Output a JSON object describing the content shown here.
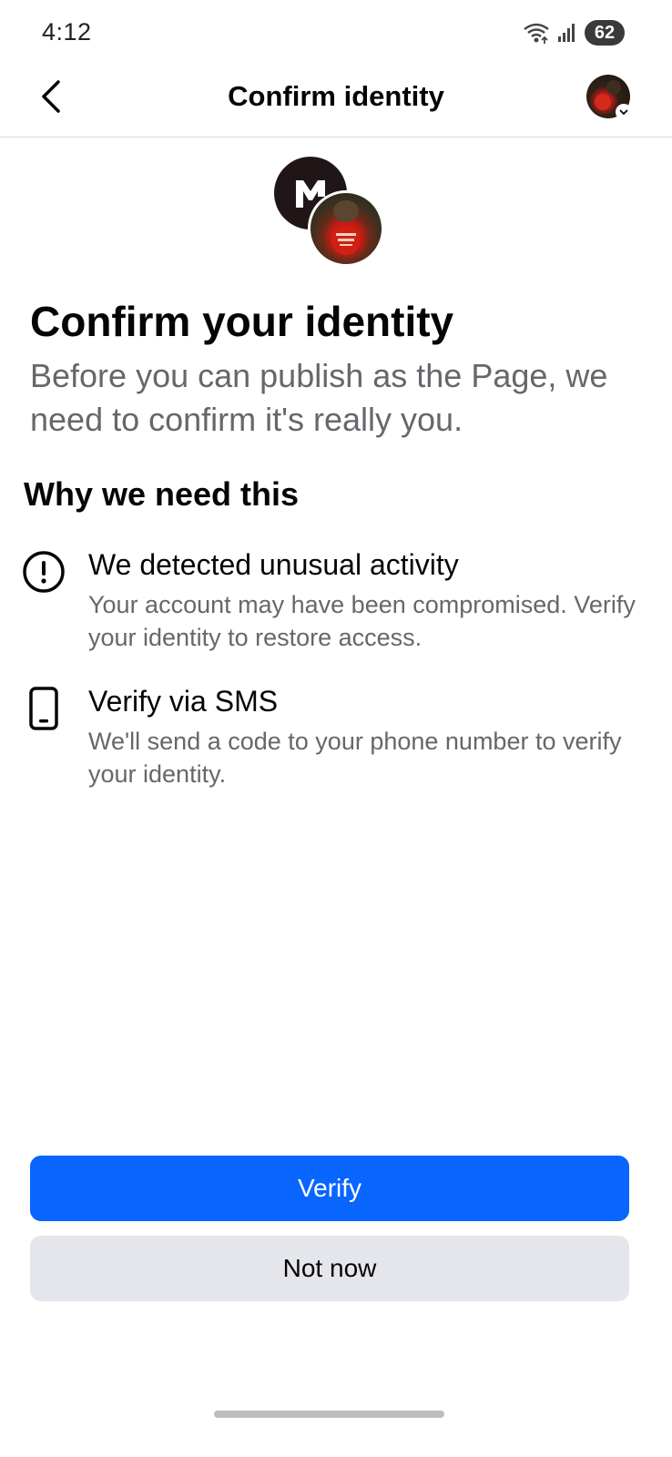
{
  "status_bar": {
    "time": "4:12",
    "battery_level": "62",
    "icons": [
      "wifi-icon",
      "signal-icon",
      "battery-icon"
    ]
  },
  "header": {
    "title": "Confirm identity",
    "back_icon": "chevron-left-icon",
    "avatar_icon": "avatar"
  },
  "content": {
    "heading": "Confirm your identity",
    "subheading": "Before you can publish as the Page, we need to confirm it's really you.",
    "section_heading": "Why we need this",
    "reasons": [
      {
        "icon": "exclamation-circle-icon",
        "title": "We detected unusual activity",
        "description": "Your account may have been compromised. Verify your identity to restore access."
      },
      {
        "icon": "phone-icon",
        "title": "Verify via SMS",
        "description": "We'll send a code to your phone number to verify your identity."
      }
    ]
  },
  "actions": {
    "primary_label": "Verify",
    "secondary_label": "Not now"
  },
  "colors": {
    "primary": "#0866ff",
    "secondary_bg": "#e4e6eb",
    "muted_text": "#65676b"
  }
}
